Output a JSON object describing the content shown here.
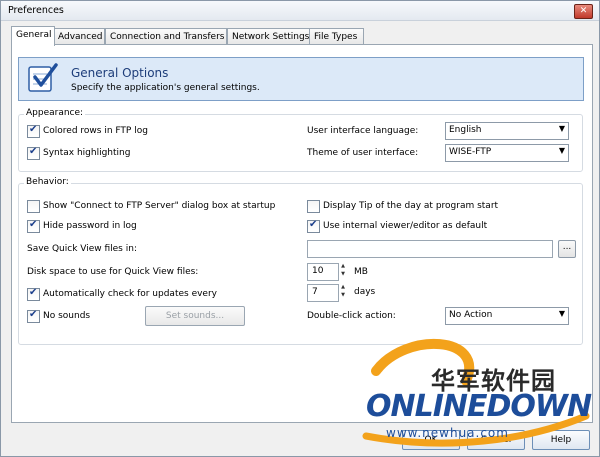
{
  "window": {
    "title": "Preferences",
    "close_glyph": "✕"
  },
  "tabs": [
    {
      "label": "General",
      "active": true
    },
    {
      "label": "Advanced"
    },
    {
      "label": "Connection and Transfers"
    },
    {
      "label": "Network Settings"
    },
    {
      "label": "File Types"
    }
  ],
  "banner": {
    "title": "General Options",
    "subtitle": "Specify the application's general settings.",
    "icon": "checklist-icon"
  },
  "appearance": {
    "label": "Appearance:",
    "colored_rows": {
      "label": "Colored rows in FTP log",
      "checked": true
    },
    "syntax_highlighting": {
      "label": "Syntax highlighting",
      "checked": true
    },
    "ui_language": {
      "label": "User interface language:",
      "value": "English"
    },
    "theme": {
      "label": "Theme of user interface:",
      "value": "WISE-FTP"
    }
  },
  "behavior": {
    "label": "Behavior:",
    "show_connect": {
      "label": "Show \"Connect to FTP Server\" dialog box at startup",
      "checked": false
    },
    "tip_of_day": {
      "label": "Display Tip of the day at program start",
      "checked": false
    },
    "hide_password": {
      "label": "Hide password in log",
      "checked": true
    },
    "internal_viewer": {
      "label": "Use internal viewer/editor as default",
      "checked": true
    },
    "save_quick_view": {
      "label": "Save Quick View files in:",
      "value": "",
      "browse": "..."
    },
    "disk_space": {
      "label": "Disk space to use for Quick View files:",
      "value": "10",
      "unit": "MB"
    },
    "auto_update": {
      "label": "Automatically check for updates every",
      "checked": true,
      "value": "7",
      "unit": "days"
    },
    "no_sounds": {
      "label": "No sounds",
      "checked": true
    },
    "set_sounds": {
      "label": "Set sounds..."
    },
    "double_click": {
      "label": "Double-click action:",
      "value": "No Action"
    }
  },
  "footer": {
    "ok": "OK",
    "cancel": "Cancel",
    "help": "Help"
  },
  "watermark": {
    "cn": "华军软件园",
    "en": "ONLINEDOWN",
    "url": "www.newhua.com"
  },
  "colors": {
    "banner_bg": "#dce9f8",
    "banner_border": "#7d9fc7",
    "accent": "#1d3d7a"
  }
}
